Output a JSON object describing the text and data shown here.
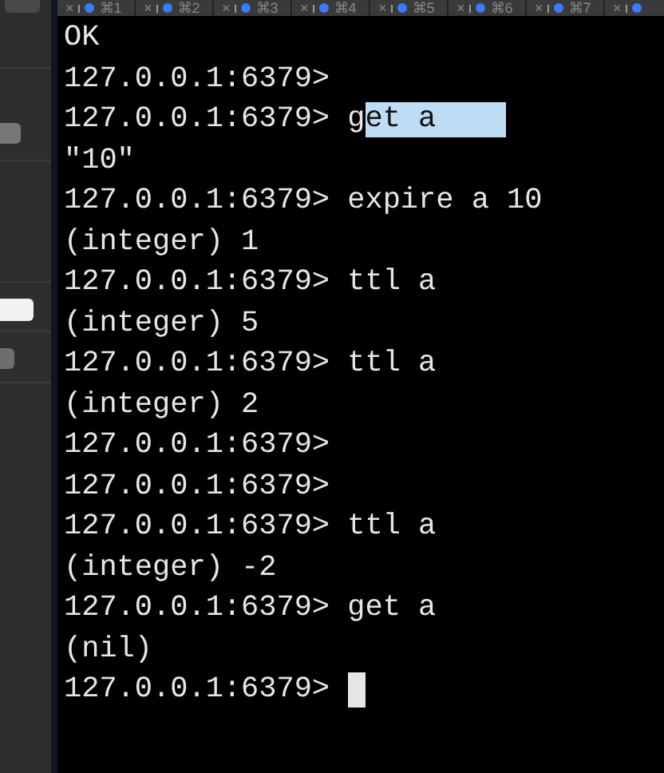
{
  "tabs": [
    {
      "close": "×",
      "label": "⌘1"
    },
    {
      "close": "×",
      "label": "⌘2"
    },
    {
      "close": "×",
      "label": "⌘3"
    },
    {
      "close": "×",
      "label": "⌘4"
    },
    {
      "close": "×",
      "label": "⌘5"
    },
    {
      "close": "×",
      "label": "⌘6"
    },
    {
      "close": "×",
      "label": "⌘7"
    },
    {
      "close": "×"
    }
  ],
  "terminal": {
    "lines": [
      {
        "text": "OK"
      },
      {
        "text": "127.0.0.1:6379>"
      },
      {
        "text": "127.0.0.1:6379> g",
        "selected_text": "et a"
      },
      {
        "text": "\"10\""
      },
      {
        "text": "127.0.0.1:6379> expire a 10"
      },
      {
        "text": "(integer) 1"
      },
      {
        "text": "127.0.0.1:6379> ttl a"
      },
      {
        "text": "(integer) 5"
      },
      {
        "text": "127.0.0.1:6379> ttl a"
      },
      {
        "text": "(integer) 2"
      },
      {
        "text": "127.0.0.1:6379>"
      },
      {
        "text": "127.0.0.1:6379>"
      },
      {
        "text": "127.0.0.1:6379> ttl a"
      },
      {
        "text": "(integer) -2"
      },
      {
        "text": "127.0.0.1:6379> get a"
      },
      {
        "text": "(nil)"
      },
      {
        "text": "127.0.0.1:6379> ",
        "cursor": true
      }
    ]
  }
}
